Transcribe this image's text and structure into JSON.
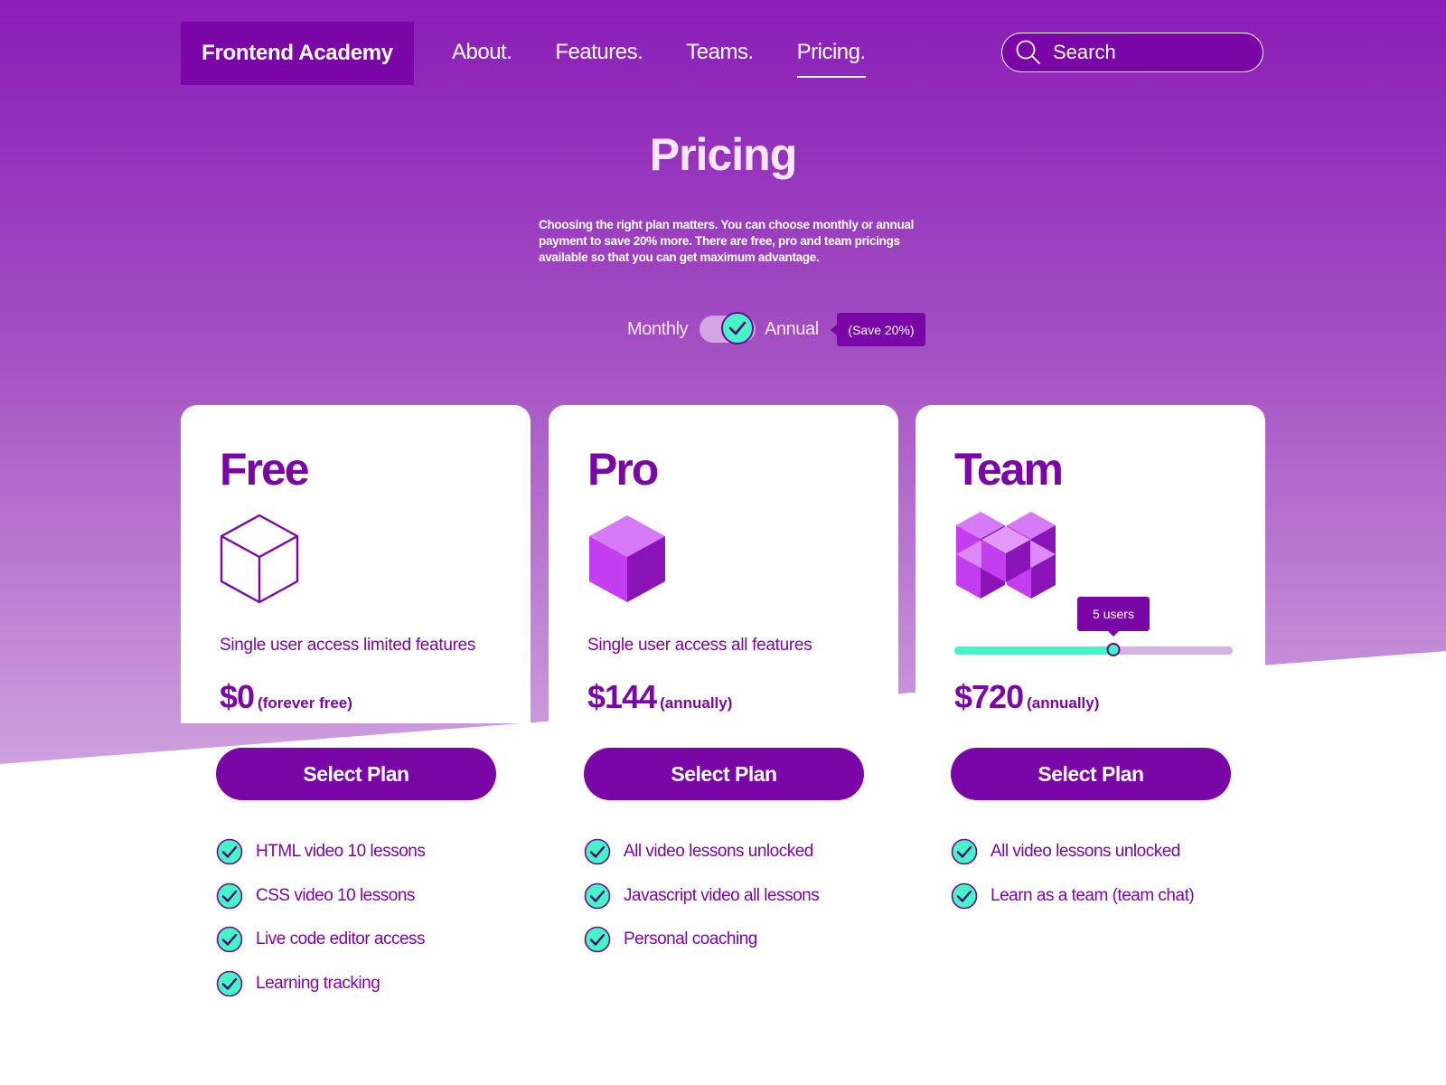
{
  "brand": "Frontend Academy",
  "nav": [
    {
      "label": "About.",
      "active": false
    },
    {
      "label": "Features.",
      "active": false
    },
    {
      "label": "Teams.",
      "active": false
    },
    {
      "label": "Pricing.",
      "active": true
    }
  ],
  "search": {
    "placeholder": "Search",
    "icon": "search-icon"
  },
  "page": {
    "title": "Pricing",
    "description": "Choosing the right plan matters. You can choose monthly or annual payment to save 20% more. There are free, pro and team pricings available so that you can get maximum advantage."
  },
  "billing_toggle": {
    "left_label": "Monthly",
    "right_label": "Annual",
    "selected": "Annual",
    "badge": "(Save 20%)"
  },
  "plans": [
    {
      "name": "Free",
      "icon": "cube-outline-icon",
      "description": "Single user access limited features",
      "price": "$0",
      "period": "(forever free)",
      "button": "Select Plan",
      "features": [
        "HTML video 10 lessons",
        "CSS video 10 lessons",
        "Live code editor access",
        "Learning tracking"
      ]
    },
    {
      "name": "Pro",
      "icon": "cube-solid-icon",
      "description": "Single user access all features",
      "price": "$144",
      "period": "(annually)",
      "button": "Select Plan",
      "features": [
        "All video lessons unlocked",
        "Javascript video all lessons",
        "Personal coaching"
      ]
    },
    {
      "name": "Team",
      "icon": "cubes-cluster-icon",
      "description": "",
      "price": "$720",
      "period": "(annually)",
      "button": "Select Plan",
      "features": [
        "All video lessons unlocked",
        "Learn as a team (team chat)"
      ],
      "users_slider": {
        "label": "5 users",
        "fraction": 0.57
      }
    }
  ],
  "colors": {
    "primary": "#7a06a8",
    "accent": "#45f4c8",
    "title": "#fbe6ff"
  }
}
